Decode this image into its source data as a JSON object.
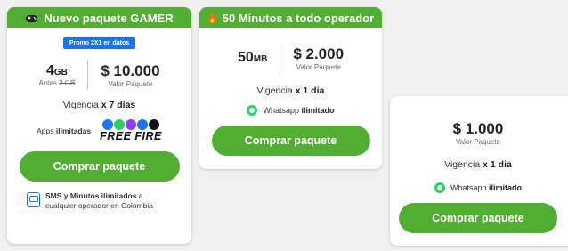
{
  "colors": {
    "brand_green": "#52ae32",
    "promo_blue": "#1a73e8",
    "whatsapp_green": "#25d366"
  },
  "card1": {
    "header_icon": "gamepad-icon",
    "title": "Nuevo paquete GAMER",
    "promo": "Promo 2X1 en datos",
    "data_amount": "4",
    "data_unit": "GB",
    "before_label": "Antes ",
    "before_value": "2 GB",
    "price": "$ 10.000",
    "price_label": "Valor Paquete",
    "validity_text": "Vigencia ",
    "validity_value": "x 7 días",
    "apps_prefix": "Apps ",
    "apps_bold": "ilimitadas",
    "app_icons": [
      "facebook-icon",
      "whatsapp-icon",
      "messenger-icon",
      "instagram-icon",
      "x-icon"
    ],
    "game_logo": "FREE FIRE",
    "button": "Comprar paquete",
    "sms_bold": "SMS y Minutos ilimitados",
    "sms_rest": " a cualquier operador en Colombia"
  },
  "card2": {
    "header_icon": "fire-icon",
    "title": "50 Minutos a todo operador",
    "data_amount": "50",
    "data_unit": "MB",
    "price": "$ 2.000",
    "price_label": "Valor Paquete",
    "validity_text": "Vigencia ",
    "validity_value": "x 1 dia",
    "whatsapp_text": "Whatsapp ",
    "whatsapp_bold": "ilimitado",
    "button": "Comprar paquete"
  },
  "card3": {
    "price": "$ 1.000",
    "price_label": "Valor Paquete",
    "validity_text": "Vigencia ",
    "validity_value": "x 1 dia",
    "whatsapp_text": "Whatsapp ",
    "whatsapp_bold": "ilimitado",
    "button": "Comprar paquete"
  }
}
